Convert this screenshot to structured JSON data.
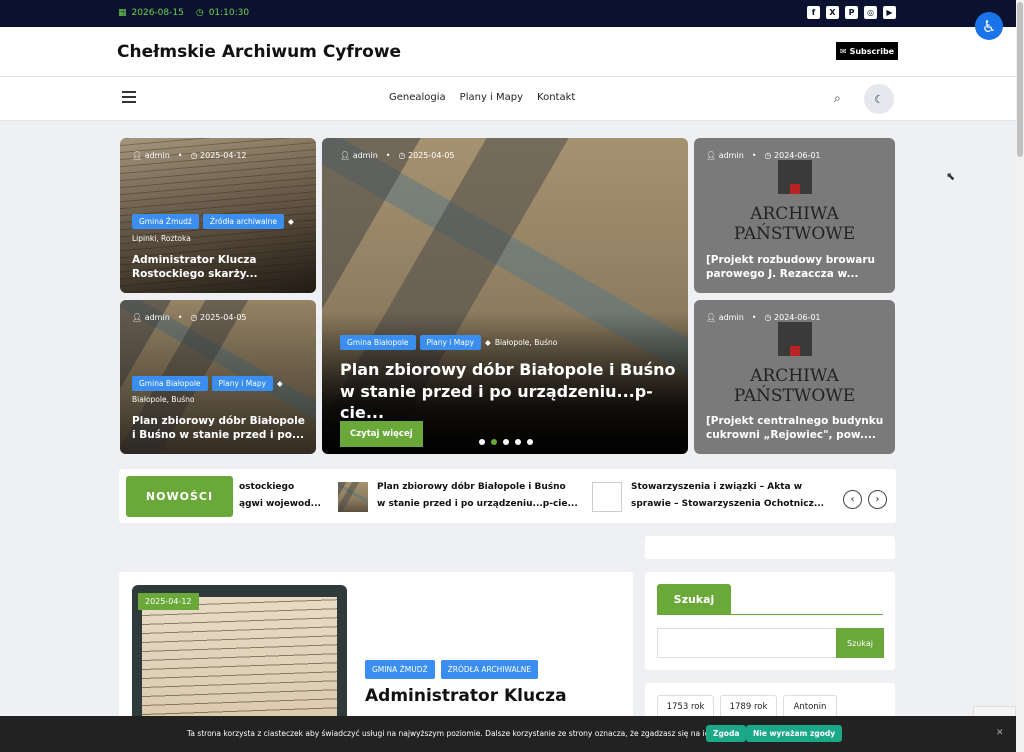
{
  "topbar": {
    "date": "2026-08-15",
    "time": "01:10:30",
    "social_icons": [
      "facebook-icon",
      "x-icon",
      "pinterest-icon",
      "instagram-icon",
      "youtube-icon"
    ]
  },
  "header": {
    "brand": "Chełmskie Archiwum Cyfrowe",
    "subscribe_label": "Subscribe"
  },
  "nav": {
    "items": [
      "Genealogia",
      "Plany i Mapy",
      "Kontakt"
    ]
  },
  "cards": [
    {
      "author": "admin",
      "date": "2025-04-12",
      "tags": [
        "Gmina Żmudź",
        "Źródła archiwalne"
      ],
      "taglist": "Lipinki, Roztoka",
      "title": "Administrator Klucza Rostockiego skarży..."
    },
    {
      "author": "admin",
      "date": "2025-04-05",
      "tags": [
        "Gmina Białopole",
        "Plany i Mapy"
      ],
      "taglist": "Białopole, Buśno",
      "title": "Plan zbiorowy dóbr Białopole i Buśno w stanie przed i po..."
    },
    {
      "author": "admin",
      "date": "2025-04-05",
      "tags": [
        "Gmina Białopole",
        "Plany i Mapy"
      ],
      "taglist": "Białopole, Buśno",
      "title": "Plan zbiorowy dóbr Białopole i Buśno w stanie przed i po urządzeniu...p-cie...",
      "button": "Czytaj więcej"
    },
    {
      "author": "admin",
      "date": "2024-06-01",
      "logo_line1": "ARCHIWA",
      "logo_line2": "PAŃSTWOWE",
      "title": "[Projekt rozbudowy browaru parowego J. Rezaccza w..."
    },
    {
      "author": "admin",
      "date": "2024-06-01",
      "logo_line1": "ARCHIWA",
      "logo_line2": "PAŃSTWOWE",
      "title": "[Projekt centralnego budynku cukrowni „Rejowiec\", pow...."
    }
  ],
  "slider": {
    "dot_count": 5,
    "active_dot": 1
  },
  "ticker": {
    "label": "NOWOŚCI",
    "items": [
      {
        "line1": "ostockiego",
        "line2": "ągwi wojewod..."
      },
      {
        "line1": "Plan zbiorowy dóbr Białopole i Buśno",
        "line2": "w stanie przed i po urządzeniu...p-cie..."
      },
      {
        "line1": "Stowarzyszenia i związki – Akta w",
        "line2": "sprawie – Stowarzyszenia Ochotnicz..."
      }
    ]
  },
  "post": {
    "date": "2025-04-12",
    "tags": [
      "GMINA ŻMUDŹ",
      "ŹRÓDŁA ARCHIWALNE"
    ],
    "title": "Administrator Klucza"
  },
  "search_widget": {
    "title": "Szukaj",
    "value": "",
    "button": "Szukaj"
  },
  "tag_cloud": [
    "1753 rok",
    "1789 rok",
    "Antonin"
  ],
  "cookie": {
    "text": "Ta strona korzysta z ciasteczek aby świadczyć usługi na najwyższym poziomie. Dalsze korzystanie ze strony oznacza, że zgadzasz się na ich użycie.",
    "accept": "Zgoda",
    "reject": "Nie wyrażam zgody"
  },
  "colors": {
    "accent": "#6aa83a",
    "tag_blue": "#3a8ef0",
    "topbar": "#0b1230",
    "cookie_btn": "#1aa889"
  }
}
